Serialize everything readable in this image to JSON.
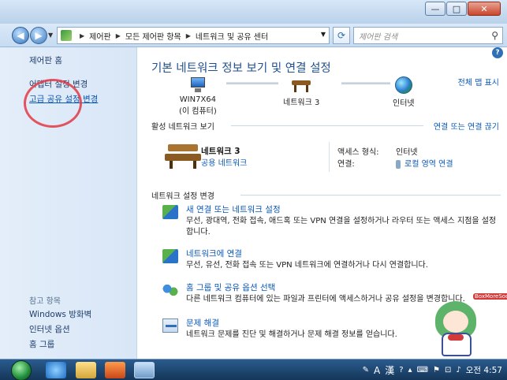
{
  "window": {
    "minimize_glyph": "—",
    "maximize_glyph": "□",
    "close_glyph": "✕"
  },
  "address": {
    "crumbs": [
      "제어판",
      "모든 제어판 항목",
      "네트워크 및 공유 센터"
    ],
    "search_placeholder": "제어판 검색"
  },
  "sidebar": {
    "home": "제어판 홈",
    "adapter_settings": "어댑터 설정 변경",
    "advanced_sharing": "고급 공유 설정 변경",
    "see_also_header": "참고 항목",
    "see_also": [
      "Windows 방화벽",
      "인터넷 옵션",
      "홈 그룹"
    ]
  },
  "main": {
    "title": "기본 네트워크 정보 보기 및 연결 설정",
    "full_map_link": "전체 맵 표시",
    "nodes": {
      "computer_name": "WIN7X64",
      "computer_sub": "(이 컴퓨터)",
      "network": "네트워크  3",
      "internet": "인터넷"
    },
    "active_section": {
      "header": "활성 네트워크 보기",
      "link": "연결 또는 연결 끊기",
      "network_name": "네트워크  3",
      "network_type": "공용 네트워크",
      "access_label": "액세스 형식:",
      "access_value": "인터넷",
      "connection_label": "연결:",
      "connection_value": "로컬 영역 연결"
    },
    "settings_section": {
      "header": "네트워크 설정 변경",
      "tasks": [
        {
          "title": "새 연결 또는 네트워크 설정",
          "desc": "무선, 광대역, 전화 접속, 애드혹 또는 VPN 연결을 설정하거나 라우터 또는 액세스 지점을 설정합니다."
        },
        {
          "title": "네트워크에 연결",
          "desc": "무선, 유선, 전화 접속 또는 VPN 네트워크에 연결하거나 다시 연결합니다."
        },
        {
          "title": "홈 그룹 및 공유 옵션 선택",
          "desc": "다른 네트워크 컴퓨터에 있는 파일과 프린터에 액세스하거나 공유 설정을 변경합니다."
        },
        {
          "title": "문제 해결",
          "desc": "네트워크 문제를 진단 및 해결하거나 문제 해결 정보를 얻습니다."
        }
      ]
    }
  },
  "mascot": {
    "tag": "BoxMoreSoon"
  },
  "taskbar": {
    "ime_label": "A",
    "hanja_label": "漢",
    "clock": "오전 4:57"
  },
  "colors": {
    "link": "#0b58b7",
    "title": "#1e4f8f",
    "annotation": "#e03a45"
  }
}
